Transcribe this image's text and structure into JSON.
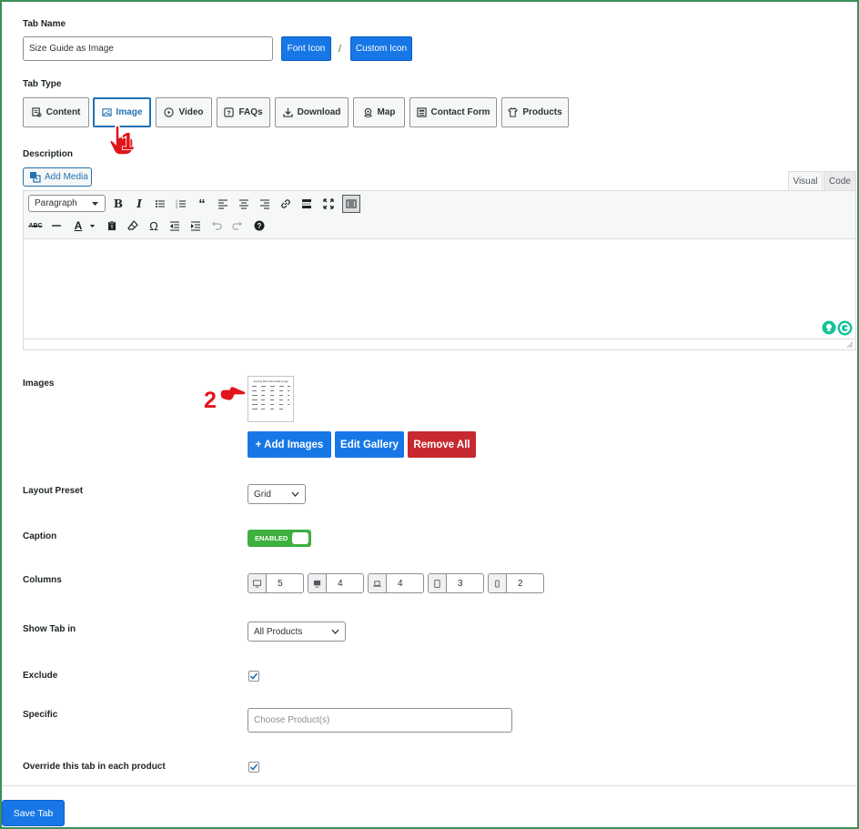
{
  "tab_name": {
    "label": "Tab Name",
    "value": "Size Guide as Image",
    "font_icon_label": "Font Icon",
    "separator": "/",
    "custom_icon_label": "Custom Icon"
  },
  "tab_type": {
    "label": "Tab Type",
    "options": [
      {
        "label": "Content",
        "icon": "content-icon"
      },
      {
        "label": "Image",
        "icon": "image-icon",
        "selected": true
      },
      {
        "label": "Video",
        "icon": "play-icon"
      },
      {
        "label": "FAQs",
        "icon": "question-icon"
      },
      {
        "label": "Download",
        "icon": "download-icon"
      },
      {
        "label": "Map",
        "icon": "map-pin-icon"
      },
      {
        "label": "Contact Form",
        "icon": "form-icon"
      },
      {
        "label": "Products",
        "icon": "shirt-icon"
      }
    ]
  },
  "annotations": {
    "step1": "1",
    "step2": "2",
    "color": "#e0151b"
  },
  "description": {
    "label": "Description",
    "add_media_label": "Add Media",
    "tab_visual": "Visual",
    "tab_code": "Code",
    "format_select": "Paragraph"
  },
  "images": {
    "label": "Images",
    "thumbnail_title": "Jumping Shoe Size Guide by Age",
    "add_images_label": "+ Add Images",
    "edit_gallery_label": "Edit Gallery",
    "remove_all_label": "Remove All"
  },
  "layout_preset": {
    "label": "Layout Preset",
    "value": "Grid"
  },
  "caption": {
    "label": "Caption",
    "toggle_text": "ENABLED",
    "enabled": true
  },
  "columns": {
    "label": "Columns",
    "values": [
      {
        "device": "large-desktop-icon",
        "value": "5"
      },
      {
        "device": "desktop-icon",
        "value": "4"
      },
      {
        "device": "laptop-icon",
        "value": "4"
      },
      {
        "device": "tablet-icon",
        "value": "3"
      },
      {
        "device": "mobile-icon",
        "value": "2"
      }
    ]
  },
  "show_tab_in": {
    "label": "Show Tab in",
    "value": "All Products"
  },
  "exclude": {
    "label": "Exclude",
    "checked": true
  },
  "specific": {
    "label": "Specific",
    "placeholder": "Choose Product(s)"
  },
  "override": {
    "label": "Override this tab in each product",
    "checked": true
  },
  "save_label": "Save Tab",
  "colors": {
    "primary": "#1877e6",
    "danger": "#c62a2f",
    "success": "#3db03f",
    "frame": "#3f8f5a"
  }
}
